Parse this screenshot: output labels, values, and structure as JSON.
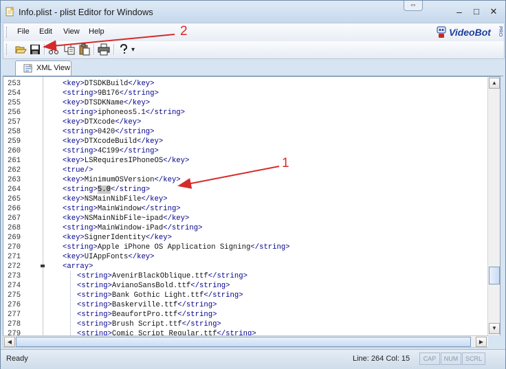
{
  "window": {
    "title": "Info.plist - plist Editor for Windows",
    "resize_glyph": "⇔",
    "minimize_glyph": "–",
    "maximize_glyph": "□",
    "close_glyph": "✕"
  },
  "menu": {
    "items": [
      {
        "label": "File"
      },
      {
        "label": "Edit"
      },
      {
        "label": "View"
      },
      {
        "label": "Help"
      }
    ],
    "logo_text": "VideoBot",
    "logo_pro": "PRO"
  },
  "toolbar": {
    "buttons": [
      "open-folder-icon",
      "save-icon",
      "cut-icon",
      "copy-icon",
      "paste-icon",
      "print-icon",
      "help-icon"
    ],
    "dropdown_glyph": "▾"
  },
  "tabs": [
    {
      "label": "XML View",
      "active": true
    }
  ],
  "editor": {
    "lines": [
      {
        "n": "253",
        "indent": 0,
        "parts": [
          [
            "tag",
            "<key>"
          ],
          [
            "txt",
            "DTSDKBuild"
          ],
          [
            "tag",
            "</key>"
          ]
        ]
      },
      {
        "n": "254",
        "indent": 0,
        "parts": [
          [
            "tag",
            "<string>"
          ],
          [
            "txt",
            "9B176"
          ],
          [
            "tag",
            "</string>"
          ]
        ]
      },
      {
        "n": "255",
        "indent": 0,
        "parts": [
          [
            "tag",
            "<key>"
          ],
          [
            "txt",
            "DTSDKName"
          ],
          [
            "tag",
            "</key>"
          ]
        ]
      },
      {
        "n": "256",
        "indent": 0,
        "parts": [
          [
            "tag",
            "<string>"
          ],
          [
            "txt",
            "iphoneos5.1"
          ],
          [
            "tag",
            "</string>"
          ]
        ]
      },
      {
        "n": "257",
        "indent": 0,
        "parts": [
          [
            "tag",
            "<key>"
          ],
          [
            "txt",
            "DTXcode"
          ],
          [
            "tag",
            "</key>"
          ]
        ]
      },
      {
        "n": "258",
        "indent": 0,
        "parts": [
          [
            "tag",
            "<string>"
          ],
          [
            "txt",
            "0420"
          ],
          [
            "tag",
            "</string>"
          ]
        ]
      },
      {
        "n": "259",
        "indent": 0,
        "parts": [
          [
            "tag",
            "<key>"
          ],
          [
            "txt",
            "DTXcodeBuild"
          ],
          [
            "tag",
            "</key>"
          ]
        ]
      },
      {
        "n": "260",
        "indent": 0,
        "parts": [
          [
            "tag",
            "<string>"
          ],
          [
            "txt",
            "4C199"
          ],
          [
            "tag",
            "</string>"
          ]
        ]
      },
      {
        "n": "261",
        "indent": 0,
        "parts": [
          [
            "tag",
            "<key>"
          ],
          [
            "txt",
            "LSRequiresIPhoneOS"
          ],
          [
            "tag",
            "</key>"
          ]
        ]
      },
      {
        "n": "262",
        "indent": 0,
        "parts": [
          [
            "tag",
            "<true/>"
          ]
        ]
      },
      {
        "n": "263",
        "indent": 0,
        "parts": [
          [
            "tag",
            "<key>"
          ],
          [
            "txt",
            "MinimumOSVersion"
          ],
          [
            "tag",
            "</key>"
          ]
        ]
      },
      {
        "n": "264",
        "indent": 0,
        "parts": [
          [
            "tag",
            "<string>"
          ],
          [
            "sel",
            "5.0"
          ],
          [
            "tag",
            "</string>"
          ]
        ]
      },
      {
        "n": "265",
        "indent": 0,
        "parts": [
          [
            "tag",
            "<key>"
          ],
          [
            "txt",
            "NSMainNibFile"
          ],
          [
            "tag",
            "</key>"
          ]
        ]
      },
      {
        "n": "266",
        "indent": 0,
        "parts": [
          [
            "tag",
            "<string>"
          ],
          [
            "txt",
            "MainWindow"
          ],
          [
            "tag",
            "</string>"
          ]
        ]
      },
      {
        "n": "267",
        "indent": 0,
        "parts": [
          [
            "tag",
            "<key>"
          ],
          [
            "txt",
            "NSMainNibFile~ipad"
          ],
          [
            "tag",
            "</key>"
          ]
        ]
      },
      {
        "n": "268",
        "indent": 0,
        "parts": [
          [
            "tag",
            "<string>"
          ],
          [
            "txt",
            "MainWindow-iPad"
          ],
          [
            "tag",
            "</string>"
          ]
        ]
      },
      {
        "n": "269",
        "indent": 0,
        "parts": [
          [
            "tag",
            "<key>"
          ],
          [
            "txt",
            "SignerIdentity"
          ],
          [
            "tag",
            "</key>"
          ]
        ]
      },
      {
        "n": "270",
        "indent": 0,
        "parts": [
          [
            "tag",
            "<string>"
          ],
          [
            "txt",
            "Apple iPhone OS Application Signing"
          ],
          [
            "tag",
            "</string>"
          ]
        ]
      },
      {
        "n": "271",
        "indent": 0,
        "parts": [
          [
            "tag",
            "<key>"
          ],
          [
            "txt",
            "UIAppFonts"
          ],
          [
            "tag",
            "</key>"
          ]
        ]
      },
      {
        "n": "272",
        "indent": 0,
        "fold": true,
        "parts": [
          [
            "tag",
            "<array>"
          ]
        ]
      },
      {
        "n": "273",
        "indent": 1,
        "parts": [
          [
            "tag",
            "<string>"
          ],
          [
            "txt",
            "AvenirBlackOblique.ttf"
          ],
          [
            "tag",
            "</string>"
          ]
        ]
      },
      {
        "n": "274",
        "indent": 1,
        "parts": [
          [
            "tag",
            "<string>"
          ],
          [
            "txt",
            "AvianoSansBold.ttf"
          ],
          [
            "tag",
            "</string>"
          ]
        ]
      },
      {
        "n": "275",
        "indent": 1,
        "parts": [
          [
            "tag",
            "<string>"
          ],
          [
            "txt",
            "Bank Gothic Light.ttf"
          ],
          [
            "tag",
            "</string>"
          ]
        ]
      },
      {
        "n": "276",
        "indent": 1,
        "parts": [
          [
            "tag",
            "<string>"
          ],
          [
            "txt",
            "Baskerville.ttf"
          ],
          [
            "tag",
            "</string>"
          ]
        ]
      },
      {
        "n": "277",
        "indent": 1,
        "parts": [
          [
            "tag",
            "<string>"
          ],
          [
            "txt",
            "BeaufortPro.ttf"
          ],
          [
            "tag",
            "</string>"
          ]
        ]
      },
      {
        "n": "278",
        "indent": 1,
        "parts": [
          [
            "tag",
            "<string>"
          ],
          [
            "txt",
            "Brush Script.ttf"
          ],
          [
            "tag",
            "</string>"
          ]
        ]
      },
      {
        "n": "279",
        "indent": 1,
        "parts": [
          [
            "tag",
            "<string>"
          ],
          [
            "txt",
            "Comic Script Regular.ttf"
          ],
          [
            "tag",
            "</string>"
          ]
        ]
      }
    ]
  },
  "status": {
    "ready": "Ready",
    "position": "Line: 264 Col: 15",
    "indicators": [
      "CAP",
      "NUM",
      "SCRL"
    ]
  },
  "annotations": {
    "label_1": "1",
    "label_2": "2",
    "arrow_color": "#d62a2a"
  }
}
